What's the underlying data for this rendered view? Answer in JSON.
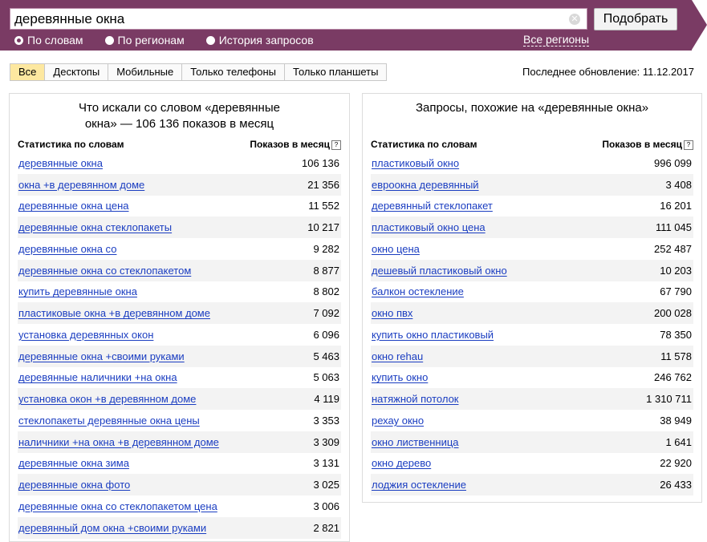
{
  "search": {
    "query": "деревянные окна",
    "button_label": "Подобрать",
    "clear_symbol": "✕",
    "modes": [
      {
        "label": "По словам",
        "selected": true
      },
      {
        "label": "По регионам",
        "selected": false
      },
      {
        "label": "История запросов",
        "selected": false
      }
    ],
    "regions_link": "Все регионы"
  },
  "tabs": [
    "Все",
    "Десктопы",
    "Мобильные",
    "Только телефоны",
    "Только планшеты"
  ],
  "active_tab": "Все",
  "last_update": "Последнее обновление: 11.12.2017",
  "left_panel": {
    "title_line1": "Что искали со словом «деревянные",
    "title_line2": "окна» — 106 136 показов в месяц",
    "col_phrase": "Статистика по словам",
    "col_count": "Показов в месяц",
    "help_symbol": "?",
    "rows": [
      {
        "phrase": "деревянные окна",
        "count": "106 136"
      },
      {
        "phrase": "окна +в деревянном доме",
        "count": "21 356"
      },
      {
        "phrase": "деревянные окна цена",
        "count": "11 552"
      },
      {
        "phrase": "деревянные окна стеклопакеты",
        "count": "10 217"
      },
      {
        "phrase": "деревянные окна со",
        "count": "9 282"
      },
      {
        "phrase": "деревянные окна со стеклопакетом",
        "count": "8 877"
      },
      {
        "phrase": "купить деревянные окна",
        "count": "8 802"
      },
      {
        "phrase": "пластиковые окна +в деревянном доме",
        "count": "7 092"
      },
      {
        "phrase": "установка деревянных окон",
        "count": "6 096"
      },
      {
        "phrase": "деревянные окна +своими руками",
        "count": "5 463"
      },
      {
        "phrase": "деревянные наличники +на окна",
        "count": "5 063"
      },
      {
        "phrase": "установка окон +в деревянном доме",
        "count": "4 119"
      },
      {
        "phrase": "стеклопакеты деревянные окна цены",
        "count": "3 353"
      },
      {
        "phrase": "наличники +на окна +в деревянном доме",
        "count": "3 309"
      },
      {
        "phrase": "деревянные окна зима",
        "count": "3 131"
      },
      {
        "phrase": "деревянные окна фото",
        "count": "3 025"
      },
      {
        "phrase": "деревянные окна со стеклопакетом цена",
        "count": "3 006"
      },
      {
        "phrase": "деревянный дом окна +своими руками",
        "count": "2 821"
      }
    ]
  },
  "right_panel": {
    "title": "Запросы, похожие на «деревянные окна»",
    "col_phrase": "Статистика по словам",
    "col_count": "Показов в месяц",
    "help_symbol": "?",
    "rows": [
      {
        "phrase": "пластиковый окно",
        "count": "996 099"
      },
      {
        "phrase": "евроокна деревянный",
        "count": "3 408"
      },
      {
        "phrase": "деревянный стеклопакет",
        "count": "16 201"
      },
      {
        "phrase": "пластиковый окно цена",
        "count": "111 045"
      },
      {
        "phrase": "окно цена",
        "count": "252 487"
      },
      {
        "phrase": "дешевый пластиковый окно",
        "count": "10 203"
      },
      {
        "phrase": "балкон остекление",
        "count": "67 790"
      },
      {
        "phrase": "окно пвх",
        "count": "200 028"
      },
      {
        "phrase": "купить окно пластиковый",
        "count": "78 350"
      },
      {
        "phrase": "окно rehau",
        "count": "11 578"
      },
      {
        "phrase": "купить окно",
        "count": "246 762"
      },
      {
        "phrase": "натяжной потолок",
        "count": "1 310 711"
      },
      {
        "phrase": "рехау окно",
        "count": "38 949"
      },
      {
        "phrase": "окно лиственница",
        "count": "1 641"
      },
      {
        "phrase": "окно дерево",
        "count": "22 920"
      },
      {
        "phrase": "лоджия остекление",
        "count": "26 433"
      }
    ]
  },
  "colors": {
    "band": "#7a3b64",
    "link": "#1a3dc1",
    "active_tab": "#fde8a0",
    "row_stripe": "#f3f3f3"
  }
}
